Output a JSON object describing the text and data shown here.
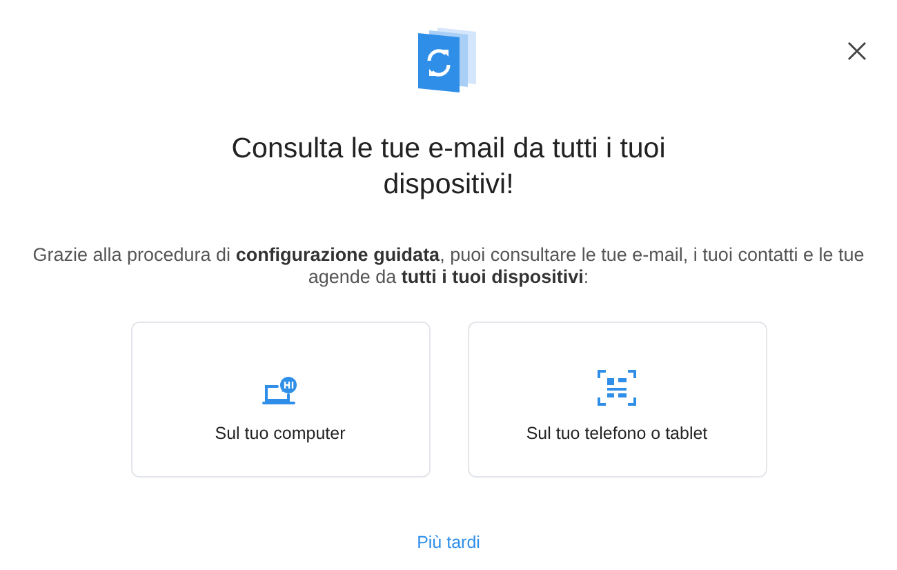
{
  "title": "Consulta le tue e-mail da tutti i tuoi dispositivi!",
  "description": "Grazie alla procedura di **configurazione guidata**, puoi consultare le tue e-mail, i tuoi contatti e le tue agende da **tutti i tuoi dispositivi**:",
  "options": [
    {
      "kind": "computer",
      "label": "Sul tuo computer"
    },
    {
      "kind": "phone",
      "label": "Sul tuo telefono o tablet"
    }
  ],
  "later_link": "Più tardi"
}
